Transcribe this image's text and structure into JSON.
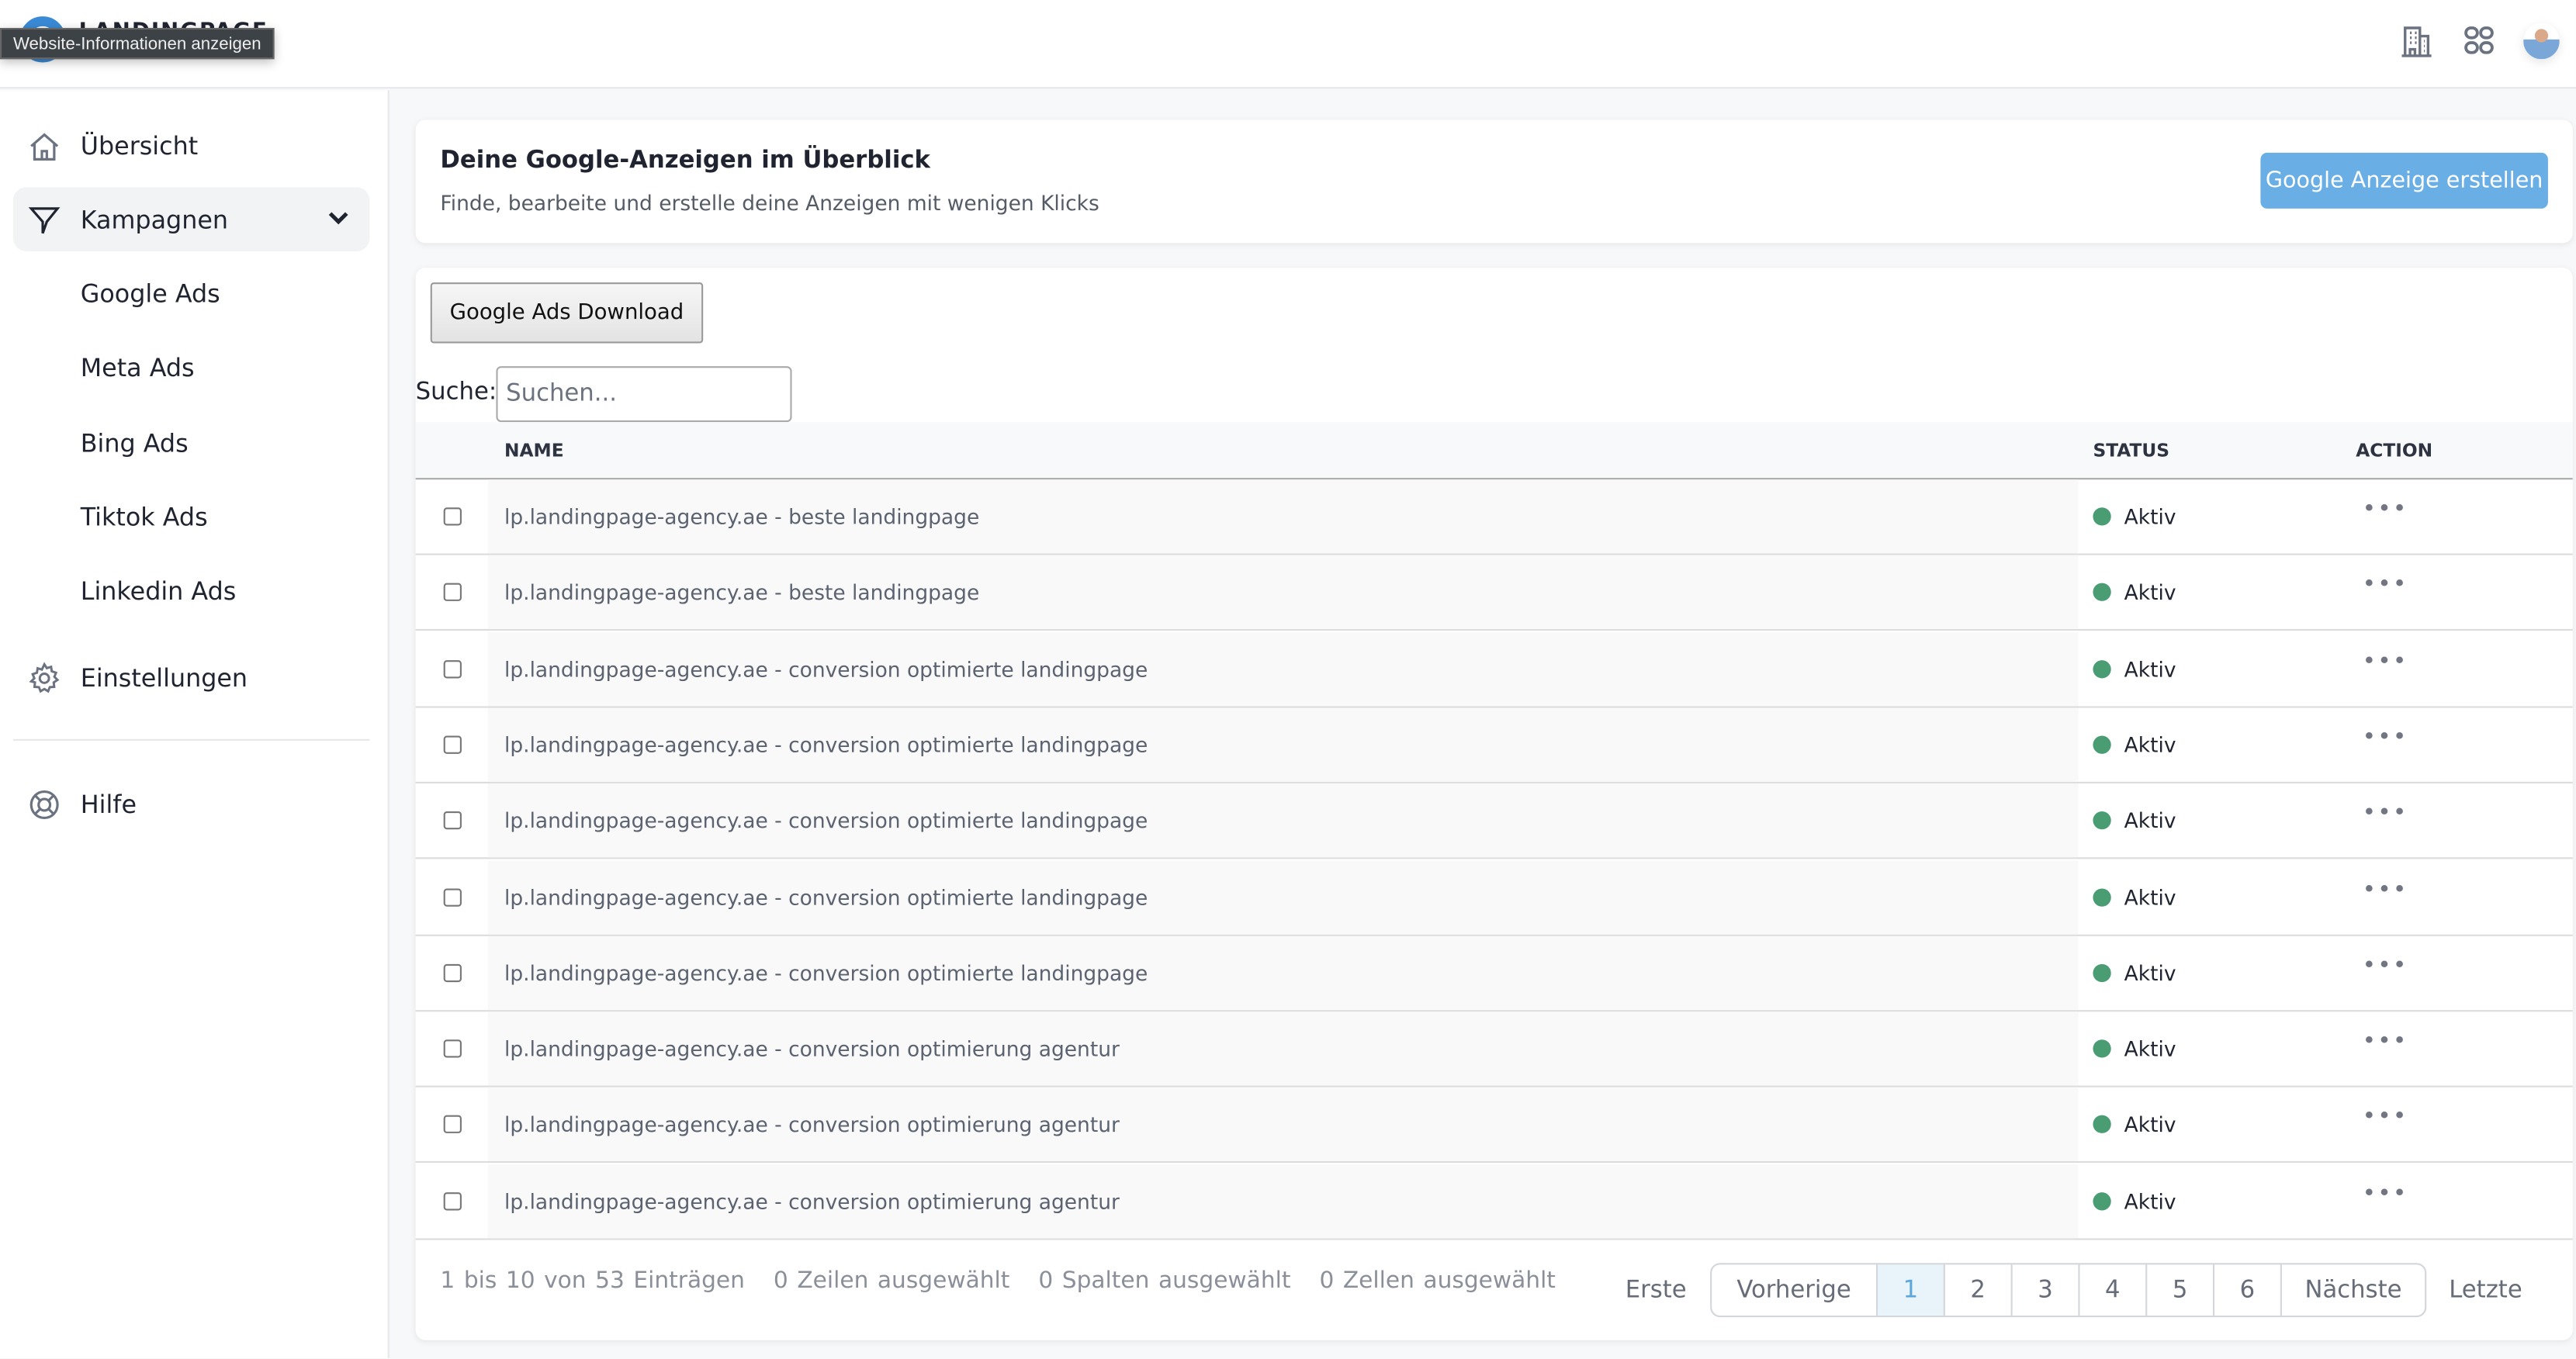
{
  "header": {
    "logo_text": "LANDINGPAGE",
    "tooltip": "Website-Informationen anzeigen",
    "icons": [
      "building-icon",
      "grid-icon",
      "avatar"
    ]
  },
  "sidebar": {
    "items": [
      {
        "label": "Übersicht",
        "icon": "home-icon"
      },
      {
        "label": "Kampagnen",
        "icon": "funnel-icon",
        "active": true
      },
      {
        "label": "Google Ads"
      },
      {
        "label": "Meta Ads"
      },
      {
        "label": "Bing Ads"
      },
      {
        "label": "Tiktok Ads"
      },
      {
        "label": "Linkedin Ads"
      },
      {
        "label": "Einstellungen",
        "icon": "gear-icon"
      },
      {
        "label": "Hilfe",
        "icon": "lifebuoy-icon"
      }
    ]
  },
  "intro": {
    "title": "Deine Google-Anzeigen im Überblick",
    "subtitle": "Finde, bearbeite und erstelle deine Anzeigen mit wenigen Klicks",
    "create_button": "Google Anzeige erstellen",
    "accent": "#6aaee6"
  },
  "table": {
    "download_button": "Google Ads Download",
    "search_label": "Suche:",
    "search_placeholder": "Suchen...",
    "search_value": "",
    "columns": [
      "NAME",
      "STATUS",
      "ACTION"
    ],
    "status_color": "#4a9d72",
    "rows": [
      {
        "name": "lp.landingpage-agency.ae - beste landingpage",
        "status": "Aktiv"
      },
      {
        "name": "lp.landingpage-agency.ae - beste landingpage",
        "status": "Aktiv"
      },
      {
        "name": "lp.landingpage-agency.ae - conversion optimierte landingpage",
        "status": "Aktiv"
      },
      {
        "name": "lp.landingpage-agency.ae - conversion optimierte landingpage",
        "status": "Aktiv"
      },
      {
        "name": "lp.landingpage-agency.ae - conversion optimierte landingpage",
        "status": "Aktiv"
      },
      {
        "name": "lp.landingpage-agency.ae - conversion optimierte landingpage",
        "status": "Aktiv"
      },
      {
        "name": "lp.landingpage-agency.ae - conversion optimierte landingpage",
        "status": "Aktiv"
      },
      {
        "name": "lp.landingpage-agency.ae - conversion optimierung agentur",
        "status": "Aktiv"
      },
      {
        "name": "lp.landingpage-agency.ae - conversion optimierung agentur",
        "status": "Aktiv"
      },
      {
        "name": "lp.landingpage-agency.ae - conversion optimierung agentur",
        "status": "Aktiv"
      }
    ],
    "action_label": "•••",
    "info": [
      "1 bis 10 von 53 Einträgen",
      "0 Zeilen ausgewählt",
      "0 Spalten ausgewählt",
      "0 Zellen ausgewählt"
    ],
    "pagination": {
      "first": "Erste",
      "prev": "Vorherige",
      "pages": [
        "1",
        "2",
        "3",
        "4",
        "5",
        "6"
      ],
      "current": "1",
      "next": "Nächste",
      "last": "Letzte"
    }
  }
}
